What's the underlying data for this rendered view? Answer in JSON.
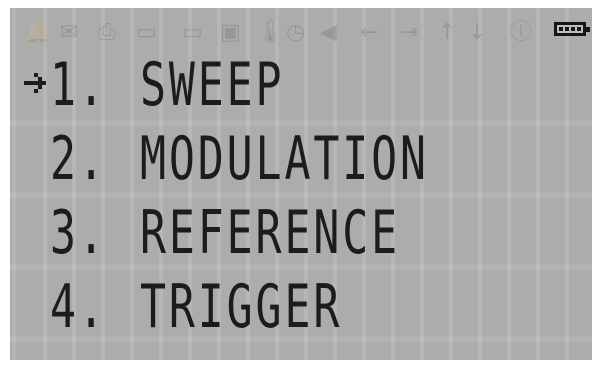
{
  "status_bar": {
    "icons": [
      "bell-icon",
      "mail-icon",
      "printer-icon",
      "monitor-icon",
      "save-icon",
      "thermometer-icon",
      "clock-icon",
      "speaker-icon",
      "arrow-left-icon",
      "arrow-right-icon",
      "arrow-up-icon",
      "arrow-down-icon",
      "info-icon"
    ],
    "battery_level": 1.0
  },
  "menu": {
    "selected_index": 0,
    "items": [
      {
        "number": "1.",
        "label": "SWEEP"
      },
      {
        "number": "2.",
        "label": "MODULATION"
      },
      {
        "number": "3.",
        "label": "REFERENCE"
      },
      {
        "number": "4.",
        "label": "TRIGGER"
      }
    ]
  },
  "colors": {
    "lcd_background": "#bdbdbd",
    "pixel_on": "#1c1c1c",
    "pixel_off": "rgba(0,0,0,0.12)"
  }
}
